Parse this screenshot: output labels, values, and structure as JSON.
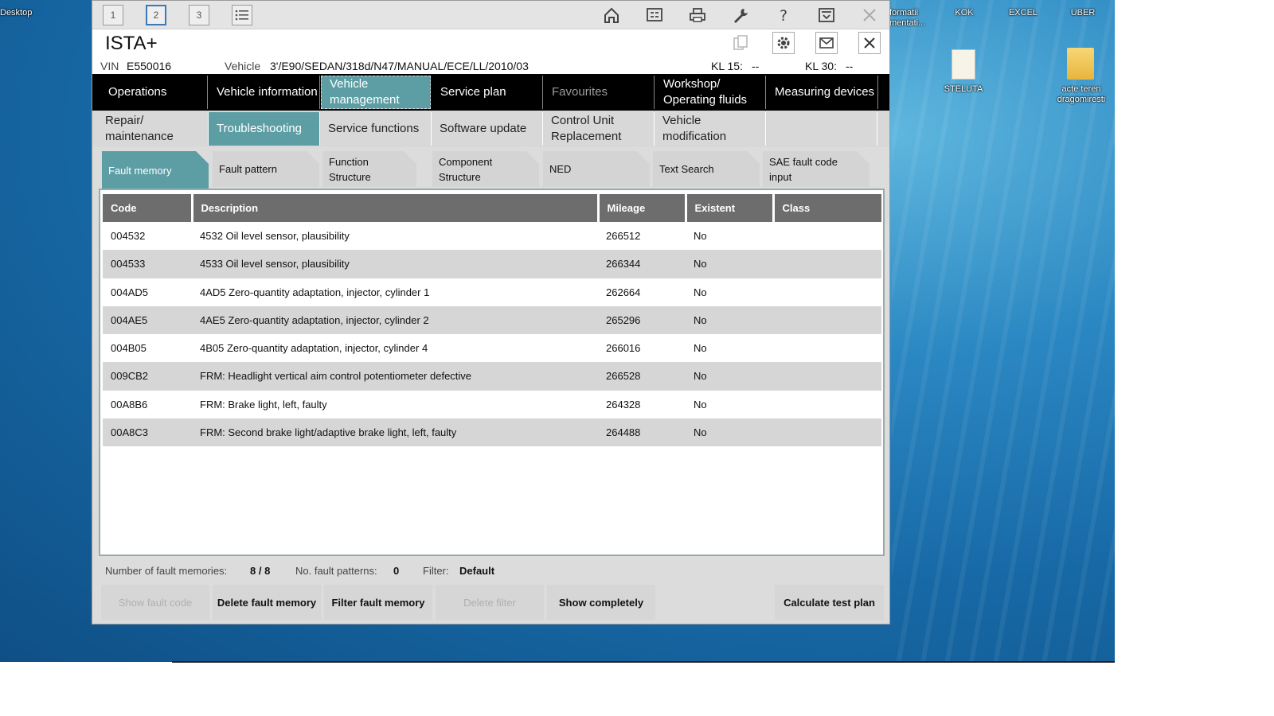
{
  "desktop": {
    "left_label": "Desktop",
    "icons_top": [
      {
        "label": "formatii\nmentati..."
      },
      {
        "label": "KOK"
      },
      {
        "label": "EXCEL"
      },
      {
        "label": "UBER"
      }
    ],
    "icons_mid": [
      {
        "label": "STELUTA"
      },
      {
        "label": "acte teren\ndragomiresti"
      }
    ]
  },
  "toolbar": {
    "tabs": [
      "1",
      "2",
      "3"
    ],
    "active_tab": "2",
    "icons": [
      "list-icon",
      "home-icon",
      "connect-icon",
      "printer-icon",
      "wrench-icon",
      "help-icon",
      "minimize-icon",
      "close-icon"
    ]
  },
  "title": {
    "app_title": "ISTA+",
    "icons": [
      "copy-icon",
      "gear-icon",
      "mail-icon",
      "close-icon"
    ]
  },
  "vin_bar": {
    "vin_label": "VIN",
    "vin_value": "E550016",
    "vehicle_label": "Vehicle",
    "vehicle_value": "3'/E90/SEDAN/318d/N47/MANUAL/ECE/LL/2010/03",
    "kl15_label": "KL 15:",
    "kl15_value": "--",
    "kl30_label": "KL 30:",
    "kl30_value": "--"
  },
  "nav_primary": [
    {
      "label": "Operations"
    },
    {
      "label": "Vehicle information"
    },
    {
      "label": "Vehicle management"
    },
    {
      "label": "Service plan"
    },
    {
      "label": "Favourites"
    },
    {
      "label": "Workshop/ Operating fluids"
    },
    {
      "label": "Measuring devices"
    }
  ],
  "nav_secondary": [
    {
      "label": "Repair/ maintenance"
    },
    {
      "label": "Troubleshooting"
    },
    {
      "label": "Service functions"
    },
    {
      "label": "Software update"
    },
    {
      "label": "Control Unit Replacement"
    },
    {
      "label": "Vehicle modification"
    }
  ],
  "tabs": [
    {
      "label": "Fault memory"
    },
    {
      "label": "Fault pattern"
    },
    {
      "label": "Function Structure"
    },
    {
      "label": "Component Structure"
    },
    {
      "label": "NED"
    },
    {
      "label": "Text Search"
    },
    {
      "label": "SAE fault code input"
    }
  ],
  "table": {
    "headers": [
      "Code",
      "Description",
      "Mileage",
      "Existent",
      "Class"
    ],
    "rows": [
      {
        "code": "004532",
        "description": "4532 Oil level sensor, plausibility",
        "mileage": "266512",
        "existent": "No",
        "class": ""
      },
      {
        "code": "004533",
        "description": "4533 Oil level sensor, plausibility",
        "mileage": "266344",
        "existent": "No",
        "class": ""
      },
      {
        "code": "004AD5",
        "description": "4AD5 Zero-quantity adaptation, injector, cylinder 1",
        "mileage": "262664",
        "existent": "No",
        "class": ""
      },
      {
        "code": "004AE5",
        "description": "4AE5 Zero-quantity adaptation, injector, cylinder 2",
        "mileage": "265296",
        "existent": "No",
        "class": ""
      },
      {
        "code": "004B05",
        "description": "4B05 Zero-quantity adaptation, injector, cylinder 4",
        "mileage": "266016",
        "existent": "No",
        "class": ""
      },
      {
        "code": "009CB2",
        "description": "FRM: Headlight vertical aim control potentiometer defective",
        "mileage": "266528",
        "existent": "No",
        "class": ""
      },
      {
        "code": "00A8B6",
        "description": "FRM: Brake light, left, faulty",
        "mileage": "264328",
        "existent": "No",
        "class": ""
      },
      {
        "code": "00A8C3",
        "description": "FRM: Second brake light/adaptive brake light, left, faulty",
        "mileage": "264488",
        "existent": "No",
        "class": ""
      }
    ]
  },
  "summary": {
    "fault_memories_label": "Number of fault memories:",
    "fault_memories_value": "8 / 8",
    "fault_patterns_label": "No. fault patterns:",
    "fault_patterns_value": "0",
    "filter_label": "Filter:",
    "filter_value": "Default"
  },
  "buttons": {
    "show_fault_code": "Show fault code",
    "delete_fault_memory": "Delete fault memory",
    "filter_fault_memory": "Filter fault memory",
    "delete_filter": "Delete filter",
    "show_completely": "Show completely",
    "calculate_test_plan": "Calculate test plan"
  },
  "colors": {
    "accent_teal": "#5d9ea4",
    "nav_black": "#000000",
    "header_gray": "#6d6d6d",
    "row_alt": "#d6d6d6"
  }
}
